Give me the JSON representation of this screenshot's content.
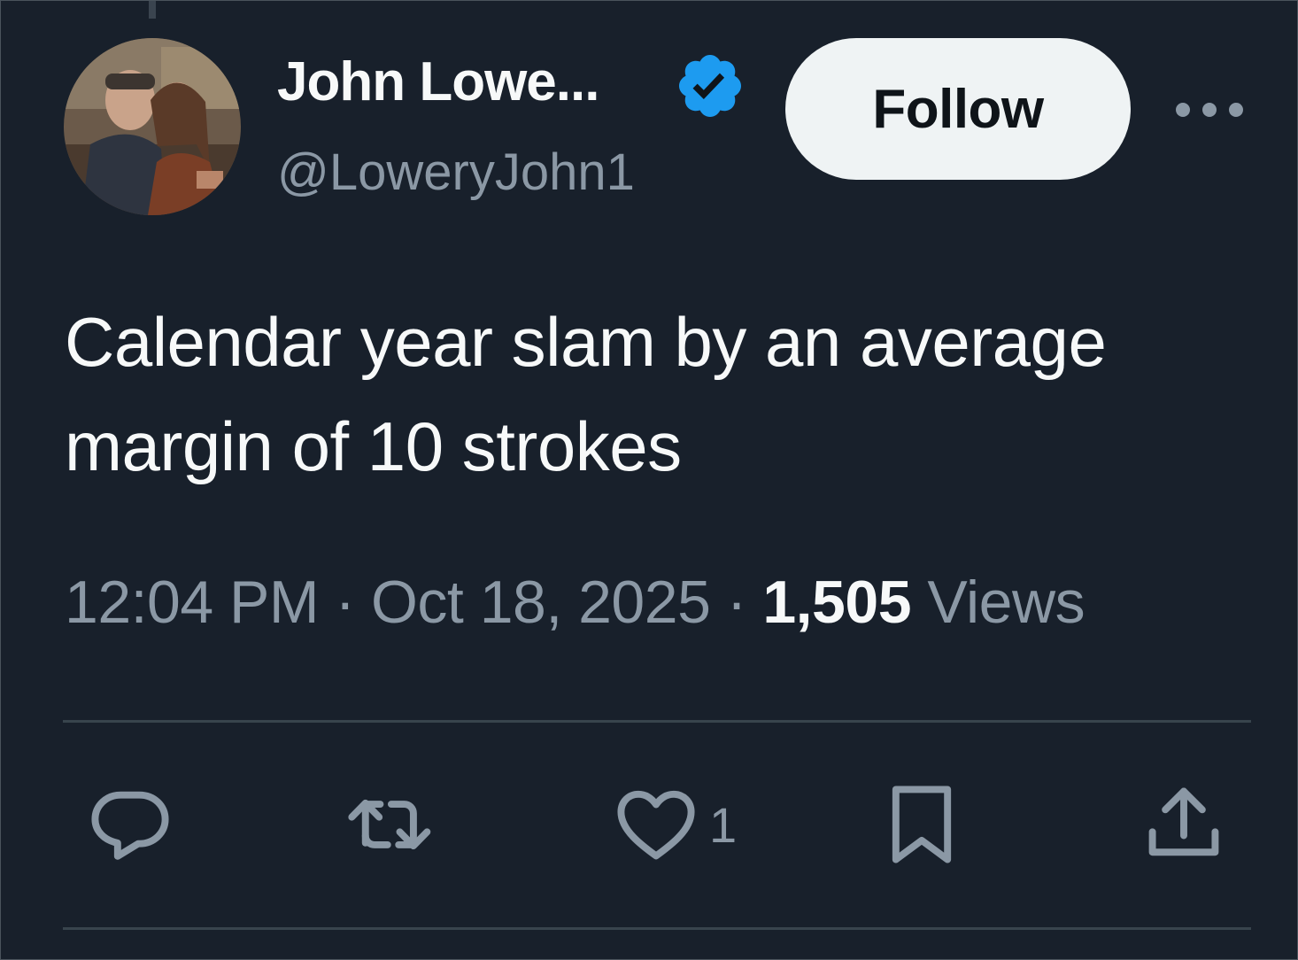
{
  "tweet": {
    "author": {
      "display_name": "John Lowe...",
      "handle": "@LoweryJohn1",
      "verified": true,
      "verified_color": "#1d9bf0"
    },
    "follow_label": "Follow",
    "text": "Calendar year slam by an average margin of 10 strokes",
    "time": "12:04 PM",
    "separator": "·",
    "date": "Oct 18, 2025",
    "views_count": "1,505",
    "views_label": "Views",
    "actions": {
      "reply_icon": "reply-icon",
      "retweet_icon": "retweet-icon",
      "like_icon": "like-icon",
      "like_count": "1",
      "bookmark_icon": "bookmark-icon",
      "share_icon": "share-icon"
    }
  },
  "colors": {
    "background": "#18202b",
    "text_primary": "#f7f9f9",
    "text_secondary": "#8b98a5",
    "follow_button_bg": "#eff3f4",
    "divider": "#38444d"
  }
}
